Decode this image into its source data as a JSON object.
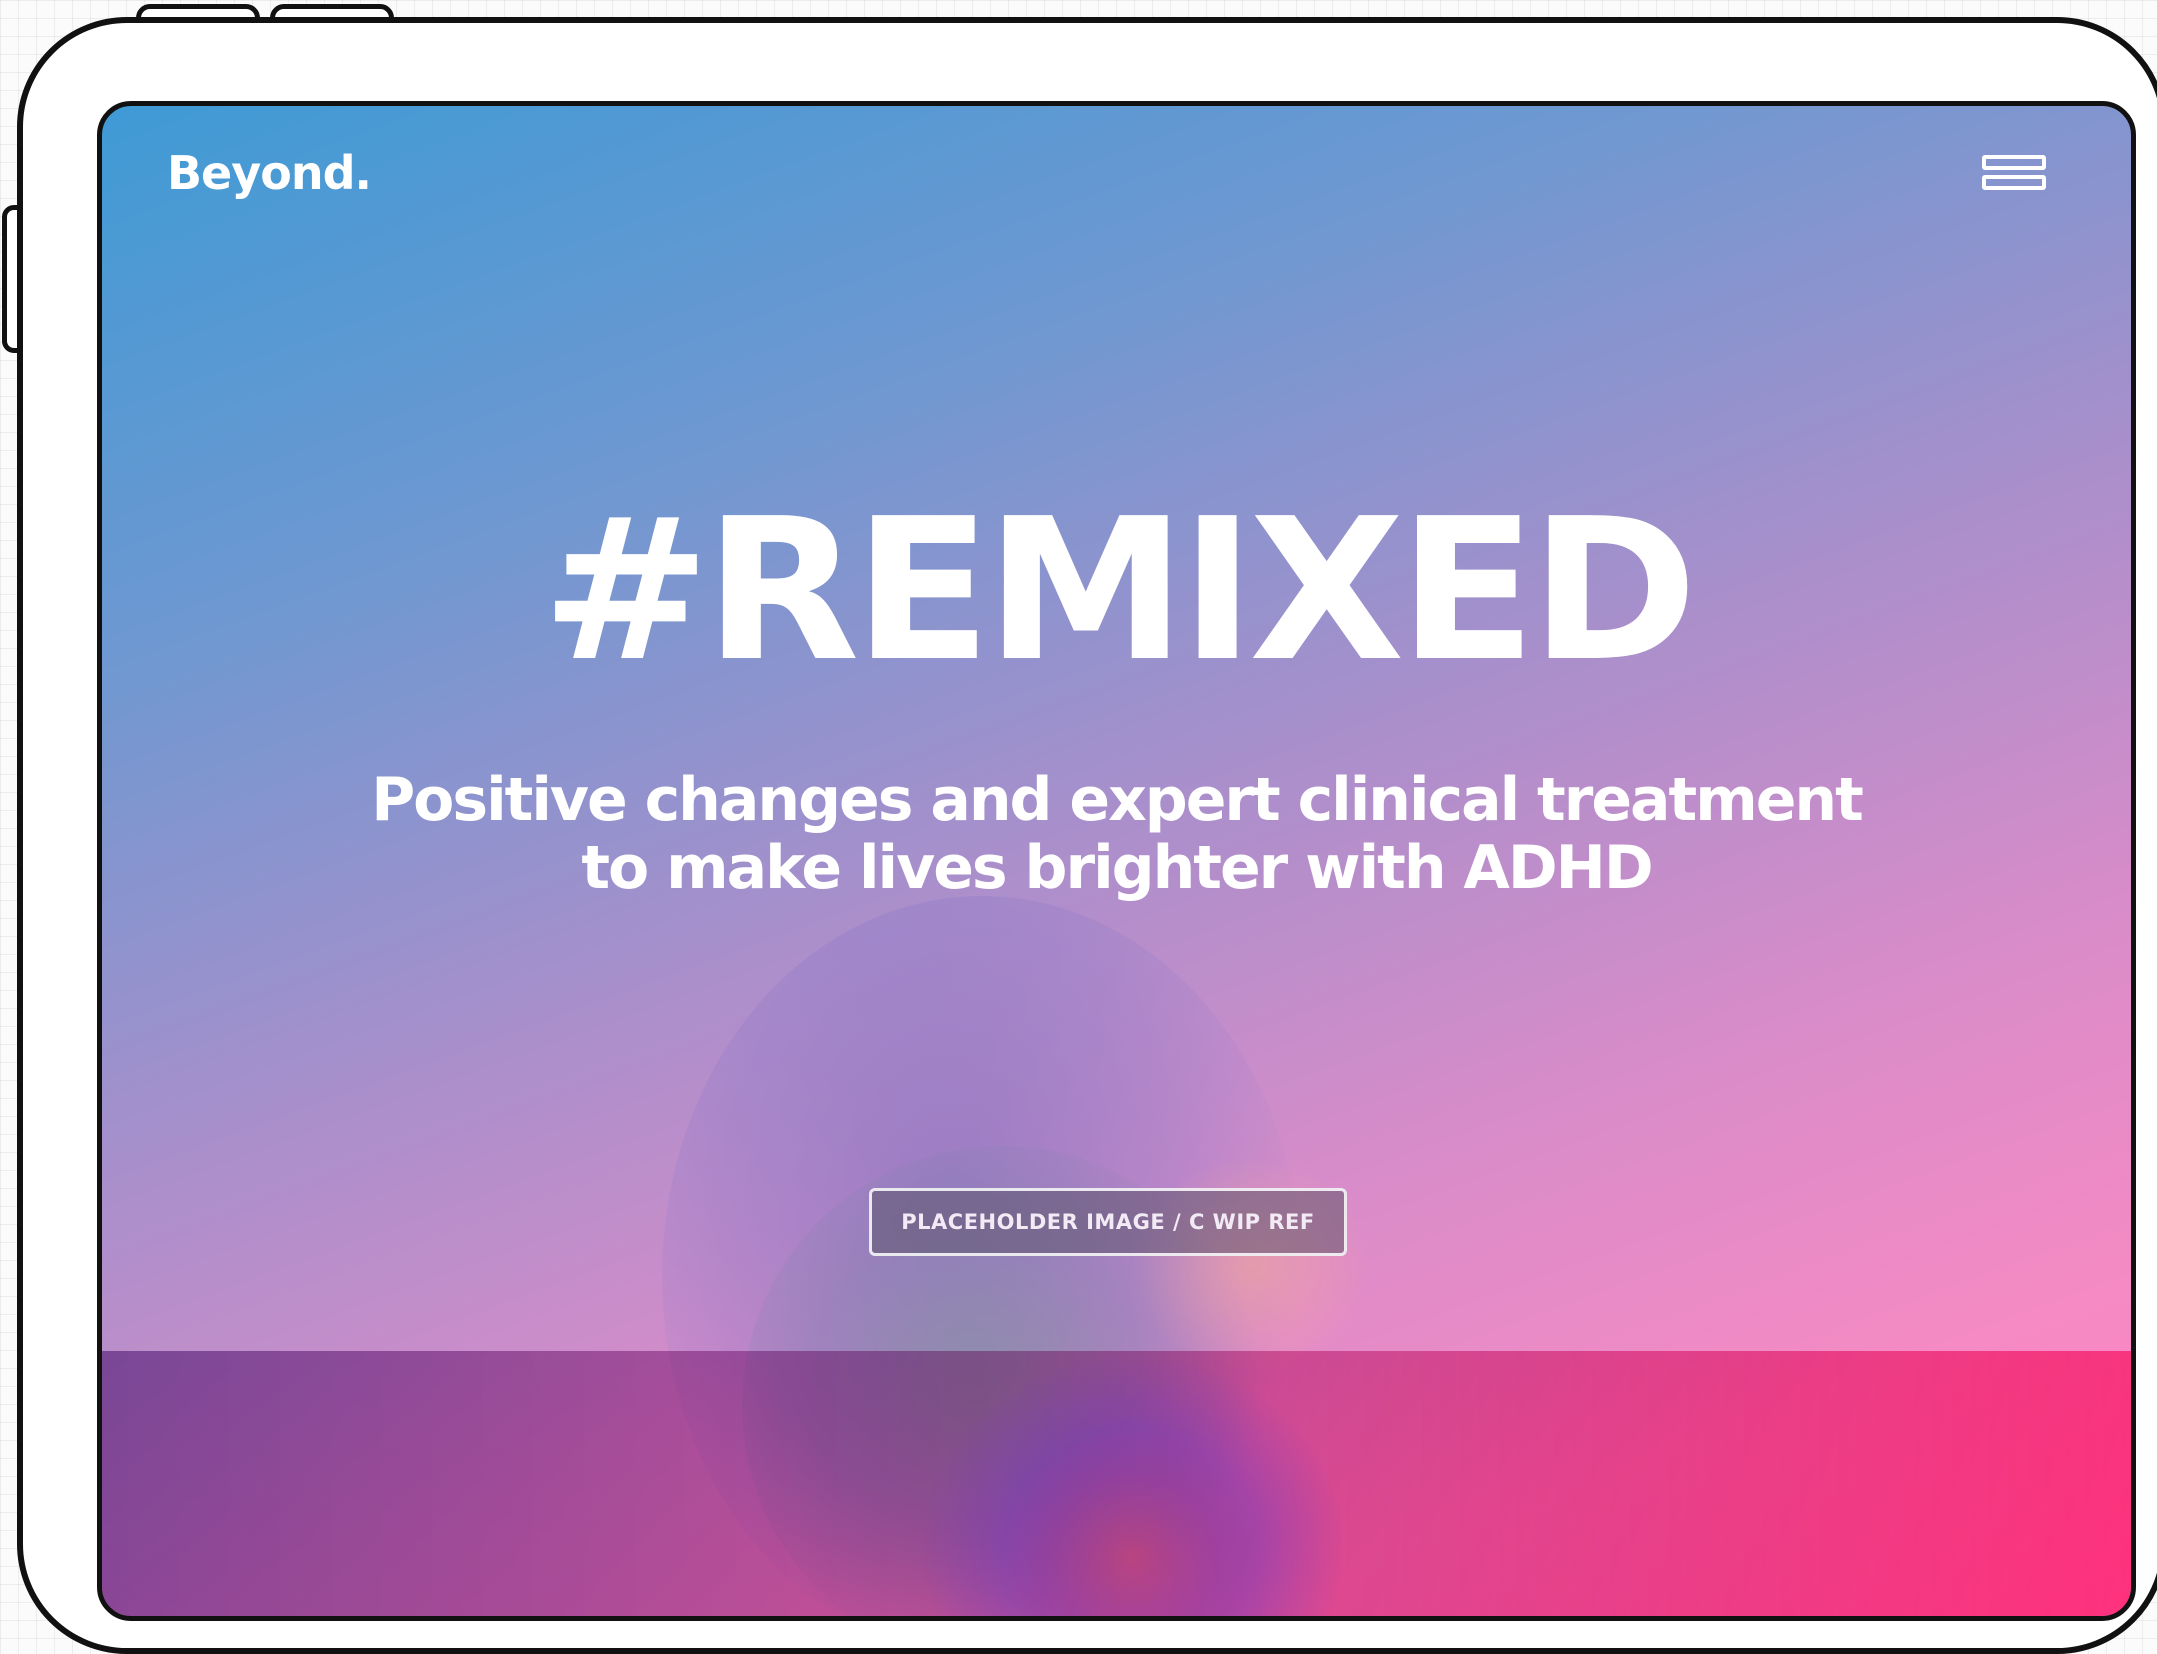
{
  "header": {
    "logo_text": "Beyond.",
    "menu_icon": "hamburger-menu-icon"
  },
  "hero": {
    "title": "#REMIXED",
    "subtitle_line_1": "Positive changes and expert clinical treatment",
    "subtitle_line_2": "to make lives brighter with ADHD"
  },
  "image": {
    "placeholder_label": "PLACEHOLDER IMAGE / C WIP REF"
  },
  "colors": {
    "gradient_start": "#3f9ad5",
    "gradient_mid": "#a98fcb",
    "gradient_end": "#ff7fc0",
    "band_pink": "#ff378c",
    "text": "#ffffff"
  }
}
